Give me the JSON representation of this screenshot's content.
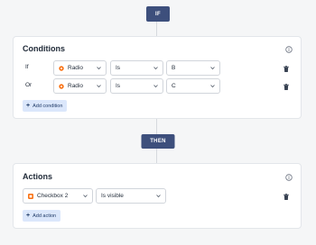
{
  "if_block": {
    "label": "IF"
  },
  "conditions": {
    "title": "Conditions",
    "info_icon": "info-circle-icon",
    "rows": [
      {
        "connector": "If",
        "field": "Radio",
        "field_icon": "radio-field-icon",
        "operator": "Is",
        "value": "B"
      },
      {
        "connector": "Or",
        "field": "Radio",
        "field_icon": "radio-field-icon",
        "operator": "Is",
        "value": "C"
      }
    ],
    "add_label": "Add condition"
  },
  "then_block": {
    "label": "THEN"
  },
  "actions": {
    "title": "Actions",
    "info_icon": "info-circle-icon",
    "rows": [
      {
        "field": "Checkbox 2",
        "field_icon": "checkbox-field-icon",
        "action": "Is visible"
      }
    ],
    "add_label": "Add action"
  },
  "colors": {
    "accent": "#3d4f7c",
    "field_icon": "#f97316",
    "add_button_bg": "#dbe7fb"
  }
}
